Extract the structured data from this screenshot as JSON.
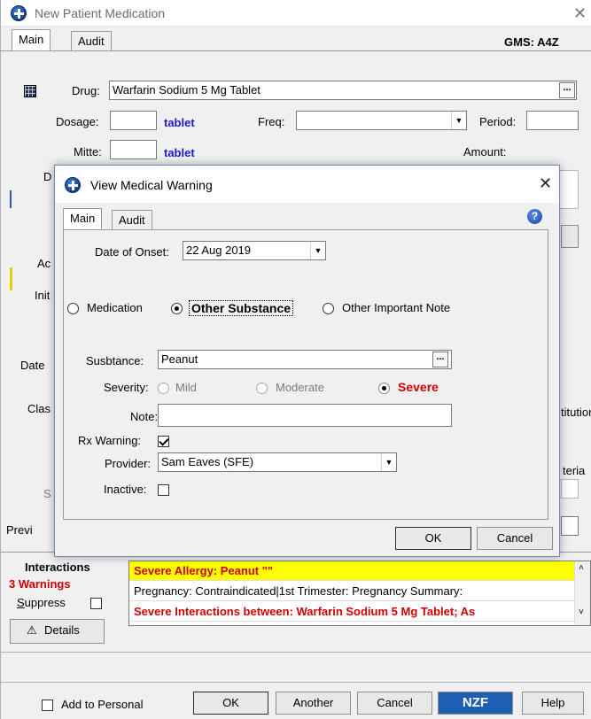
{
  "window": {
    "title": "New Patient Medication"
  },
  "main": {
    "tabs": [
      {
        "label": "Main"
      },
      {
        "label": "Audit"
      }
    ],
    "gms_label": "GMS: A4Z",
    "drug_label": "Drug:",
    "drug_value": "Warfarin Sodium 5 Mg Tablet",
    "dosage_label": "Dosage:",
    "dosage_unit": "tablet",
    "freq_label": "Freq:",
    "period_label": "Period:",
    "mitte_label": "Mitte:",
    "mitte_unit": "tablet",
    "amount_label": "Amount:",
    "partial_labels": {
      "d": "D",
      "ac": "Ac",
      "init": "Init",
      "date": "Date",
      "clas": "Clas",
      "s": "S",
      "previ": "Previ",
      "titution": "titution",
      "teria": "teria"
    }
  },
  "interactions": {
    "title": "Interactions",
    "warnings_count": "3 Warnings",
    "suppress_label": "Suppress",
    "details_label": "Details",
    "rows": [
      {
        "text": "Severe Allergy: Peanut \"\""
      },
      {
        "text": "Pregnancy: Contraindicated|1st Trimester: Pregnancy Summary:"
      },
      {
        "text": "Severe Interactions between: Warfarin Sodium 5 Mg Tablet; As"
      }
    ]
  },
  "bottom": {
    "add_to_personal": "Add to Personal",
    "ok": "OK",
    "another": "Another",
    "cancel": "Cancel",
    "nzf": "NZF",
    "help": "Help"
  },
  "dialog": {
    "title": "View Medical Warning",
    "tabs": [
      {
        "label": "Main"
      },
      {
        "label": "Audit"
      }
    ],
    "help_glyph": "?",
    "onset_label": "Date of Onset:",
    "onset_value": "22 Aug 2019",
    "type_options": {
      "medication": "Medication",
      "other_substance": "Other Substance",
      "other_note": "Other Important Note",
      "selected": "Other Substance"
    },
    "substance_label": "Susbtance:",
    "substance_value": "Peanut",
    "severity_label": "Severity:",
    "severity_options": {
      "mild": "Mild",
      "moderate": "Moderate",
      "severe": "Severe",
      "selected": "Severe"
    },
    "note_label": "Note:",
    "note_value": "",
    "rx_warning_label": "Rx Warning:",
    "rx_warning_checked": true,
    "provider_label": "Provider:",
    "provider_value": "Sam Eaves (SFE)",
    "inactive_label": "Inactive:",
    "inactive_checked": false,
    "ok": "OK",
    "cancel": "Cancel"
  },
  "icons": {
    "app": "medical-cross-icon",
    "drug_lookup": "grid-icon",
    "warning": "warning-triangle-icon",
    "help": "help-icon",
    "close": "close-icon"
  },
  "colors": {
    "allergy_highlight": "#ffff00",
    "severe_red": "#d00000",
    "unit_blue": "#1a1acc",
    "nzf_blue": "#1d5fb3"
  }
}
